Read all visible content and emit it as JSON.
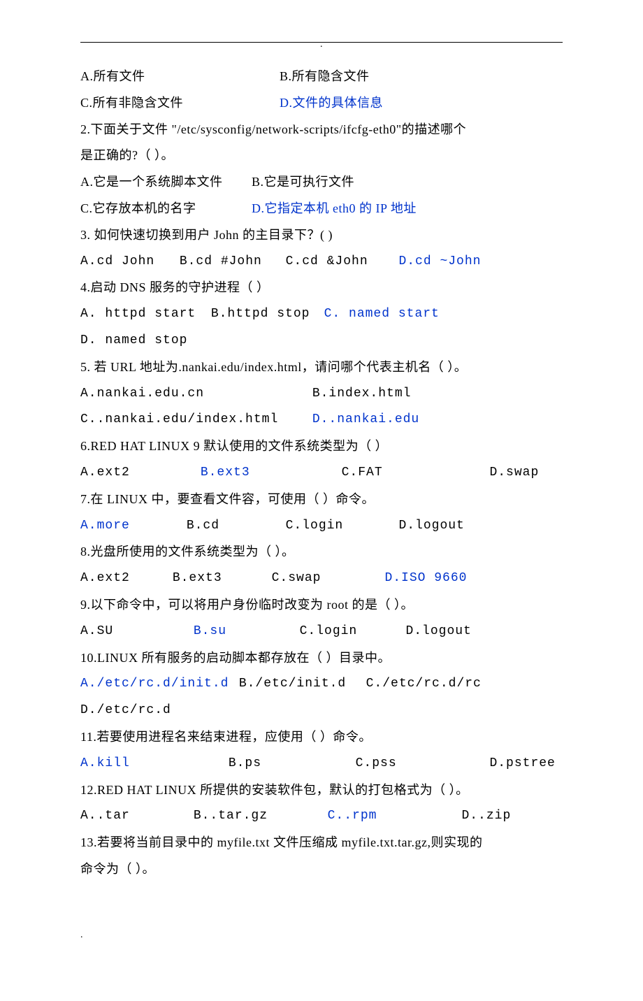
{
  "header_dot": ".",
  "footer_dot": ".",
  "q1": {
    "a": "A.所有文件",
    "b": "B.所有隐含文件",
    "c": "C.所有非隐含文件",
    "d": "D.文件的具体信息"
  },
  "q2": {
    "stem1": "2.下面关于文件 \"/etc/sysconfig/network-scripts/ifcfg-eth0\"的描述哪个",
    "stem2": "是正确的?（   ）。",
    "a": "A.它是一个系统脚本文件",
    "b": "B.它是可执行文件",
    "c": "C.它存放本机的名字",
    "d": "D.它指定本机 eth0 的 IP 地址"
  },
  "q3": {
    "stem": "3. 如何快速切换到用户 John 的主目录下？(   )",
    "a": "A.cd  John",
    "b": "B.cd #John",
    "c": "C.cd  &John",
    "d": "D.cd  ~John"
  },
  "q4": {
    "stem": "4.启动 DNS 服务的守护进程（    ）",
    "a": "A. httpd start",
    "b": "B.httpd stop",
    "c": "C. named start",
    "d": "D. named stop"
  },
  "q5": {
    "stem": "5. 若 URL 地址为.nankai.edu/index.html，请问哪个代表主机名（   ）。",
    "a": "A.nankai.edu.cn",
    "b": "B.index.html",
    "c": "C..nankai.edu/index.html",
    "d": "D..nankai.edu"
  },
  "q6": {
    "stem": "6.RED HAT LINUX 9 默认使用的文件系统类型为（    ）",
    "a": "A.ext2",
    "b": "B.ext3",
    "c": "C.FAT",
    "d": "D.swap"
  },
  "q7": {
    "stem": "7.在 LINUX 中，要查看文件容，可使用（   ）命令。",
    "a": "A.more",
    "b": "B.cd",
    "c": "C.login",
    "d": "D.logout"
  },
  "q8": {
    "stem": "8.光盘所使用的文件系统类型为（   ）。",
    "a": "A.ext2",
    "b": "B.ext3",
    "c": "C.swap",
    "d": "D.ISO 9660"
  },
  "q9": {
    "stem": "9.以下命令中，可以将用户身份临时改变为 root 的是（   ）。",
    "a": "A.SU",
    "b": "B.su",
    "c": "C.login",
    "d": "D.logout"
  },
  "q10": {
    "stem": "10.LINUX 所有服务的启动脚本都存放在（   ）目录中。",
    "a": "A./etc/rc.d/init.d",
    "b": "B./etc/init.d",
    "c": "C./etc/rc.d/rc",
    "d": "D./etc/rc.d"
  },
  "q11": {
    "stem": "11.若要使用进程名来结束进程，应使用（   ）命令。",
    "a": "A.kill",
    "b": "B.ps",
    "c": "C.pss",
    "d": "D.pstree"
  },
  "q12": {
    "stem": "12.RED HAT LINUX 所提供的安装软件包，默认的打包格式为（   ）。",
    "a": "A..tar",
    "b": "B..tar.gz",
    "c": "C..rpm",
    "d": "D..zip"
  },
  "q13": {
    "stem1": "13.若要将当前目录中的 myfile.txt 文件压缩成 myfile.txt.tar.gz,则实现的",
    "stem2": "命令为（    ）。"
  }
}
